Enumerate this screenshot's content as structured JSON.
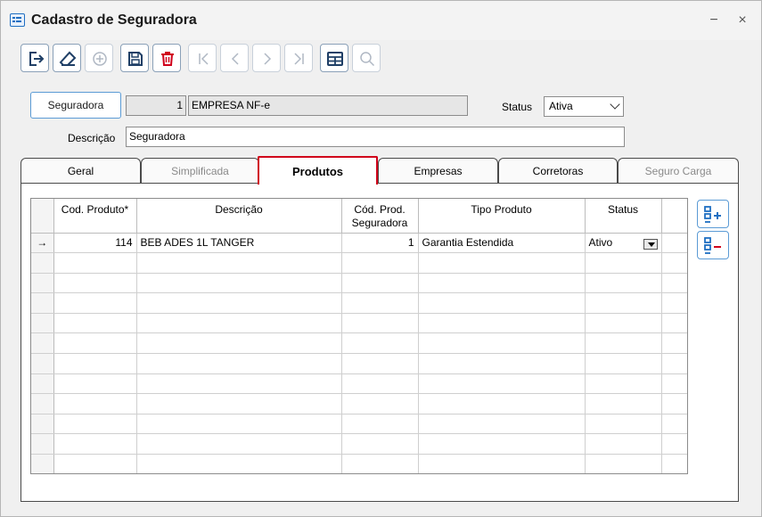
{
  "window": {
    "title": "Cadastro de Seguradora",
    "minimize": "−",
    "close": "×"
  },
  "toolbar": {
    "buttons": [
      "exit-icon",
      "eraser-icon",
      "add-circle-icon",
      "save-icon",
      "delete-icon",
      "first-icon",
      "prev-icon",
      "next-icon",
      "last-icon",
      "grid-icon",
      "search-icon"
    ]
  },
  "form": {
    "seguradora_button": "Seguradora",
    "codigo": "1",
    "nome": "EMPRESA NF-e",
    "status_label": "Status",
    "status_value": "Ativa",
    "descricao_label": "Descrição",
    "descricao_value": "Seguradora"
  },
  "tabs": [
    "Geral",
    "Simplificada",
    "Produtos",
    "Empresas",
    "Corretoras",
    "Seguro Carga"
  ],
  "active_tab": "Produtos",
  "grid": {
    "headers": {
      "cod_produto": "Cod. Produto*",
      "descricao": "Descrição",
      "cod_prod_seg_1": "Cód. Prod.",
      "cod_prod_seg_2": "Seguradora",
      "tipo_produto": "Tipo Produto",
      "status": "Status"
    },
    "rows": [
      {
        "indicator": "→",
        "cod_produto": "114",
        "descricao": "BEB ADES 1L TANGER",
        "cod_prod_seg": "1",
        "tipo_produto": "Garantia Estendida",
        "status": "Ativo"
      }
    ]
  },
  "colors": {
    "accent": "#1f6fc2",
    "active_tab_border": "#d0021b",
    "delete": "#d0021b"
  }
}
